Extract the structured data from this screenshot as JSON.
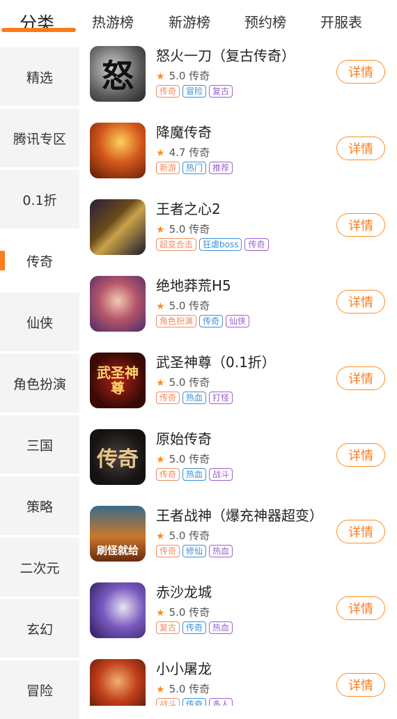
{
  "tabs": [
    "分类",
    "热游榜",
    "新游榜",
    "预约榜",
    "开服表"
  ],
  "sidebar": [
    "精选",
    "腾讯专区",
    "0.1折",
    "传奇",
    "仙侠",
    "角色扮演",
    "三国",
    "策略",
    "二次元",
    "玄幻",
    "冒险"
  ],
  "active_sidebar": "传奇",
  "colors": {
    "accent": "#ff7a1a",
    "tag_orange": "#f08a5d",
    "tag_blue": "#3a8fd6",
    "tag_purple": "#9a5fd1"
  },
  "games": [
    {
      "name": "怒火一刀（复古传奇）",
      "rating": "5.0",
      "genre": "传奇",
      "tags": [
        "传奇",
        "冒险",
        "复古"
      ],
      "icon": "fire-blade-icon",
      "icon_text": "怒"
    },
    {
      "name": "降魔传奇",
      "rating": "4.7",
      "genre": "传奇",
      "tags": [
        "新游",
        "热门",
        "推荐"
      ],
      "icon": "dragon-warrior-icon",
      "icon_text": ""
    },
    {
      "name": "王者之心2",
      "rating": "5.0",
      "genre": "传奇",
      "tags": [
        "超变合击",
        "狂虐boss",
        "传奇"
      ],
      "icon": "golden-sword-icon",
      "icon_text": ""
    },
    {
      "name": "绝地莽荒H5",
      "rating": "5.0",
      "genre": "传奇",
      "tags": [
        "角色扮演",
        "传奇",
        "仙侠"
      ],
      "icon": "heroine-portrait-icon",
      "icon_text": ""
    },
    {
      "name": "武圣神尊（0.1折）",
      "rating": "5.0",
      "genre": "传奇",
      "tags": [
        "传奇",
        "热血",
        "打怪"
      ],
      "icon": "wusheng-logo-icon",
      "icon_text": "武圣神尊"
    },
    {
      "name": "原始传奇",
      "rating": "5.0",
      "genre": "传奇",
      "tags": [
        "传奇",
        "热血",
        "战斗"
      ],
      "icon": "yuanshi-logo-icon",
      "icon_text": "传奇"
    },
    {
      "name": "王者战神（爆充神器超变）",
      "rating": "5.0",
      "genre": "传奇",
      "tags": [
        "传奇",
        "修仙",
        "热血"
      ],
      "icon": "battle-scene-icon",
      "icon_text": "刷怪就给"
    },
    {
      "name": "赤沙龙城",
      "rating": "5.0",
      "genre": "传奇",
      "tags": [
        "复古",
        "传奇",
        "热血"
      ],
      "icon": "white-tiger-icon",
      "icon_text": ""
    },
    {
      "name": "小小屠龙",
      "rating": "5.0",
      "genre": "传奇",
      "tags": [
        "战斗",
        "传奇",
        "多人"
      ],
      "icon": "dragon-slayer-icon",
      "icon_text": ""
    }
  ],
  "detail_label": "详情"
}
